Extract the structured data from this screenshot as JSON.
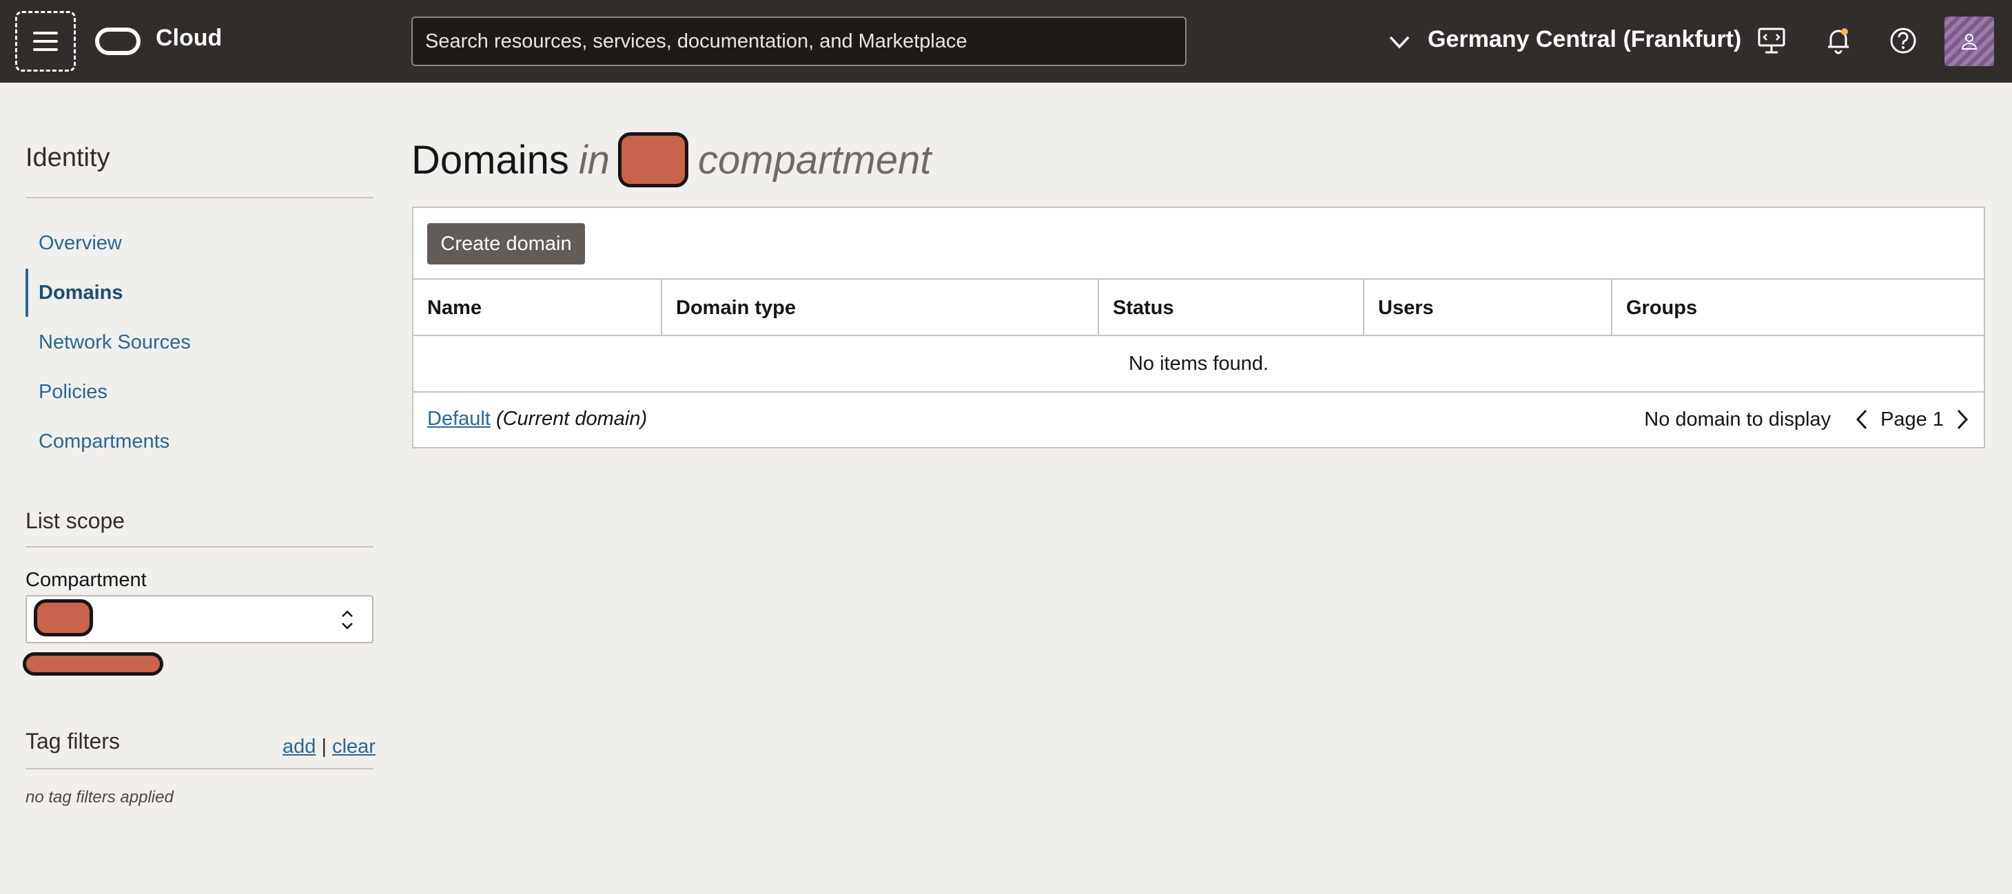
{
  "header": {
    "brand": "Cloud",
    "search_placeholder": "Search resources, services, documentation, and Marketplace",
    "region": "Germany Central (Frankfurt)"
  },
  "sidebar": {
    "title": "Identity",
    "items": [
      {
        "label": "Overview",
        "active": false
      },
      {
        "label": "Domains",
        "active": true
      },
      {
        "label": "Network Sources",
        "active": false
      },
      {
        "label": "Policies",
        "active": false
      },
      {
        "label": "Compartments",
        "active": false
      }
    ],
    "list_scope": "List scope",
    "compartment_label": "Compartment",
    "tag_filters": "Tag filters",
    "tag_add": "add",
    "tag_separator": "|",
    "tag_clear": "clear",
    "no_filters": "no tag filters applied"
  },
  "main": {
    "title_prefix": "Domains",
    "title_in": "in",
    "title_suffix": "compartment",
    "create_button": "Create domain",
    "columns": [
      "Name",
      "Domain type",
      "Status",
      "Users",
      "Groups"
    ],
    "empty_message": "No items found.",
    "footer_link": "Default",
    "footer_note": "(Current domain)",
    "no_display": "No domain to display",
    "page_label": "Page 1"
  },
  "colors": {
    "topbar": "#312d2a",
    "link": "#2a6793",
    "redaction": "#c8634c"
  }
}
